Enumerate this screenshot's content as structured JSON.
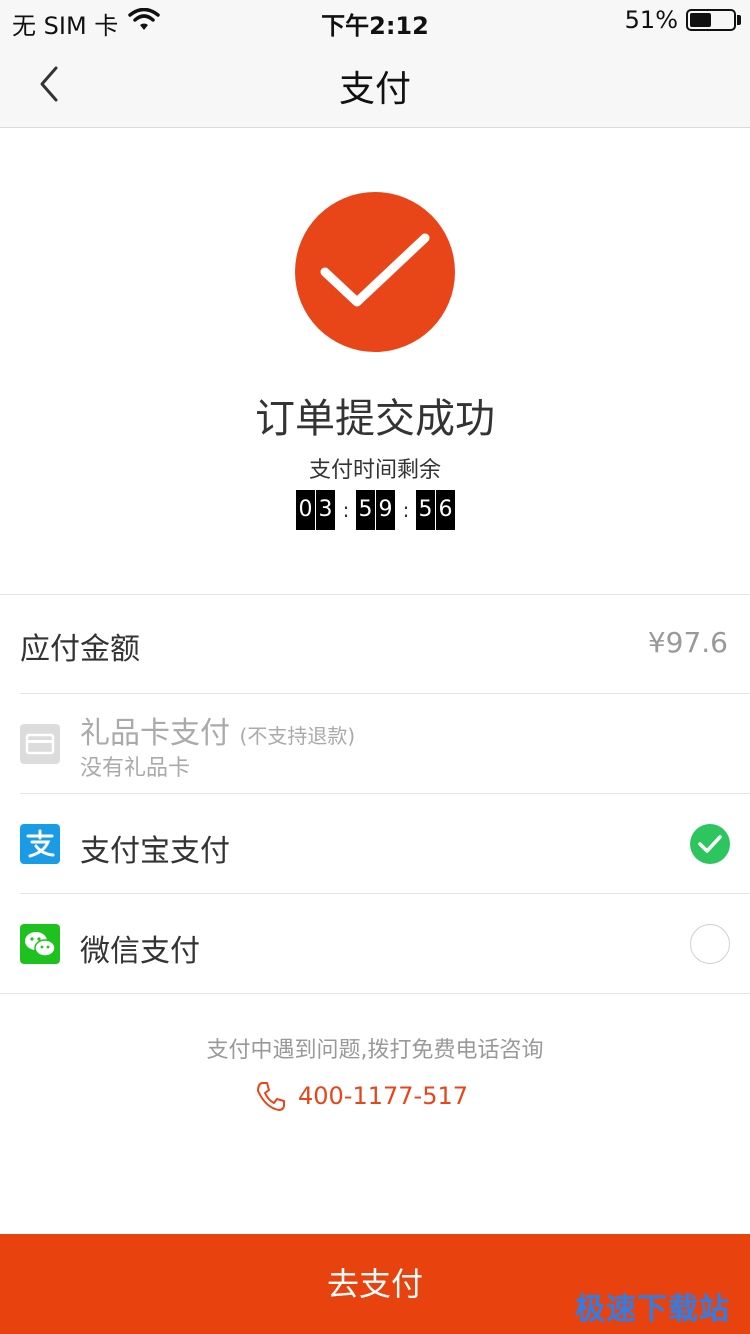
{
  "status_bar": {
    "carrier": "无 SIM 卡",
    "time": "下午2:12",
    "battery": "51%",
    "battery_level": 0.51
  },
  "nav": {
    "title": "支付",
    "back_icon": "chevron-left-icon"
  },
  "success": {
    "icon": "checkmark-circle-icon",
    "title": "订单提交成功",
    "countdown_label": "支付时间剩余",
    "countdown": {
      "h1": "0",
      "h2": "3",
      "m1": "5",
      "m2": "9",
      "s1": "5",
      "s2": "6",
      "separator": ":"
    }
  },
  "amount": {
    "label": "应付金额",
    "value": "¥97.6"
  },
  "payment_methods": [
    {
      "icon": "gift-card-icon",
      "title": "礼品卡支付",
      "note": "(不支持退款)",
      "subtitle": "没有礼品卡",
      "disabled": true
    },
    {
      "icon": "alipay-icon",
      "title": "支付宝支付",
      "selected": true
    },
    {
      "icon": "wechat-pay-icon",
      "title": "微信支付",
      "selected": false
    }
  ],
  "help": {
    "text": "支付中遇到问题,拨打免费电话咨询",
    "phone": "400-1177-517",
    "phone_icon": "phone-icon"
  },
  "pay_button": {
    "label": "去支付"
  },
  "watermark": "极速下载站",
  "colors": {
    "accent": "#e84519",
    "button": "#e8420f",
    "alipay": "#1a9be6",
    "wechat": "#1ec21e",
    "selected_check": "#2cc55e"
  }
}
